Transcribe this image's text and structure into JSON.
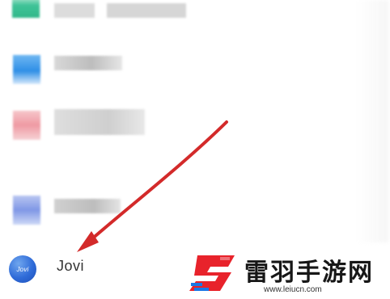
{
  "list": {
    "items": [
      {
        "id": "blurred-app-1",
        "blurred": true,
        "icon_color": "#3fc397"
      },
      {
        "id": "blurred-app-2",
        "blurred": true,
        "icon_color": "#2f8fe6"
      },
      {
        "id": "blurred-app-3",
        "blurred": true,
        "icon_color": "#ef9aa3"
      },
      {
        "id": "blurred-app-4",
        "blurred": true,
        "icon_color": "#7f97e6"
      }
    ],
    "jovi": {
      "label": "Jovi",
      "icon_text": "Jovi",
      "icon_color": "#2f6bd8"
    }
  },
  "annotation": {
    "arrow_color": "#d32a2a"
  },
  "watermark": {
    "name": "雷羽手游网",
    "url": "www.leiucn.com",
    "logo_colors": [
      "#e8232b",
      "#1a78e6"
    ]
  }
}
